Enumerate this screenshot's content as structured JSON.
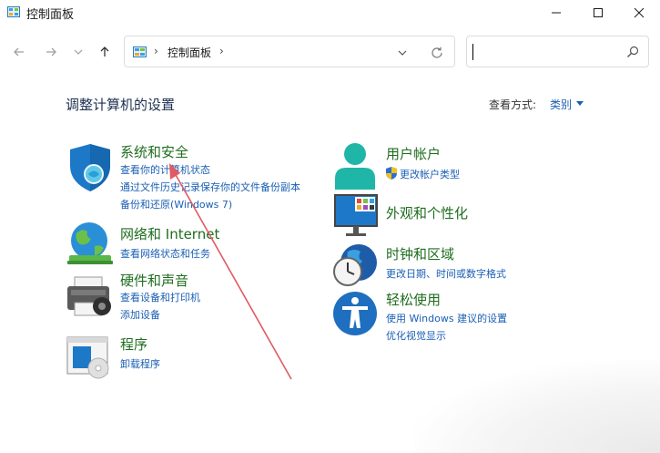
{
  "window": {
    "title": "控制面板"
  },
  "address": {
    "path": "控制面板",
    "search_value": ""
  },
  "header": {
    "title": "调整计算机的设置",
    "view_label": "查看方式:",
    "view_value": "类别"
  },
  "categories": {
    "security": {
      "title": "系统和安全",
      "links": [
        "查看你的计算机状态",
        "通过文件历史记录保存你的文件备份副本",
        "备份和还原(Windows 7)"
      ]
    },
    "network": {
      "title": "网络和 Internet",
      "links": [
        "查看网络状态和任务"
      ]
    },
    "hardware": {
      "title": "硬件和声音",
      "links": [
        "查看设备和打印机",
        "添加设备"
      ]
    },
    "programs": {
      "title": "程序",
      "links": [
        "卸载程序"
      ]
    },
    "accounts": {
      "title": "用户帐户",
      "links": [
        "更改帐户类型"
      ]
    },
    "appearance": {
      "title": "外观和个性化",
      "links": []
    },
    "clock": {
      "title": "时钟和区域",
      "links": [
        "更改日期、时间或数字格式"
      ]
    },
    "ease": {
      "title": "轻松使用",
      "links": [
        "使用 Windows 建议的设置",
        "优化视觉显示"
      ]
    }
  },
  "colors": {
    "link": "#1a5fb4",
    "category_title": "#1f6e1f",
    "annotation_arrow": "#e05a64"
  }
}
